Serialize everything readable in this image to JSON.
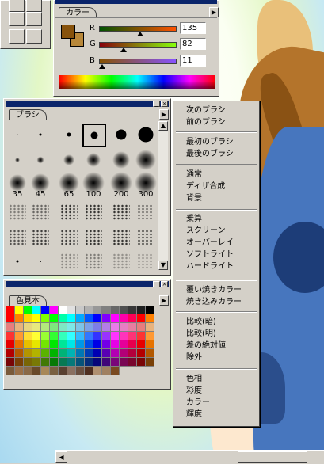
{
  "color_palette": {
    "tab_label": "カラー",
    "r_label": "R",
    "g_label": "G",
    "b_label": "B",
    "r_value": "135",
    "g_value": "82",
    "b_value": "11",
    "r_level": 0.53,
    "g_level": 0.32,
    "b_level": 0.04,
    "foreground_color": "#87520b",
    "background_color": "#b8883a"
  },
  "brush_palette": {
    "tab_label": "ブラシ",
    "size_labels": [
      "35",
      "45",
      "65",
      "100",
      "200",
      "300"
    ]
  },
  "swatches_palette": {
    "tab_label": "色見本"
  },
  "context_menu": {
    "groups": [
      [
        "次のブラシ",
        "前のブラシ"
      ],
      [
        "最初のブラシ",
        "最後のブラシ"
      ],
      [
        "通常",
        "ディザ合成",
        "背景"
      ],
      [
        "乗算",
        "スクリーン",
        "オーバーレイ",
        "ソフトライト",
        "ハードライト"
      ],
      [
        "覆い焼きカラー",
        "焼き込みカラー"
      ],
      [
        "比較(暗)",
        "比較(明)",
        "差の絶対値",
        "除外"
      ],
      [
        "色相",
        "彩度",
        "カラー",
        "輝度"
      ]
    ]
  },
  "icons": {
    "menu_arrow": "triangle-right",
    "minimize": "minimize-icon",
    "close": "close-icon",
    "scroll_up": "triangle-up",
    "scroll_down": "triangle-down",
    "scroll_left": "triangle-left",
    "scroll_right": "triangle-right"
  },
  "colors": {
    "title_bar": "#0a246a",
    "face": "#d4d0c8"
  }
}
